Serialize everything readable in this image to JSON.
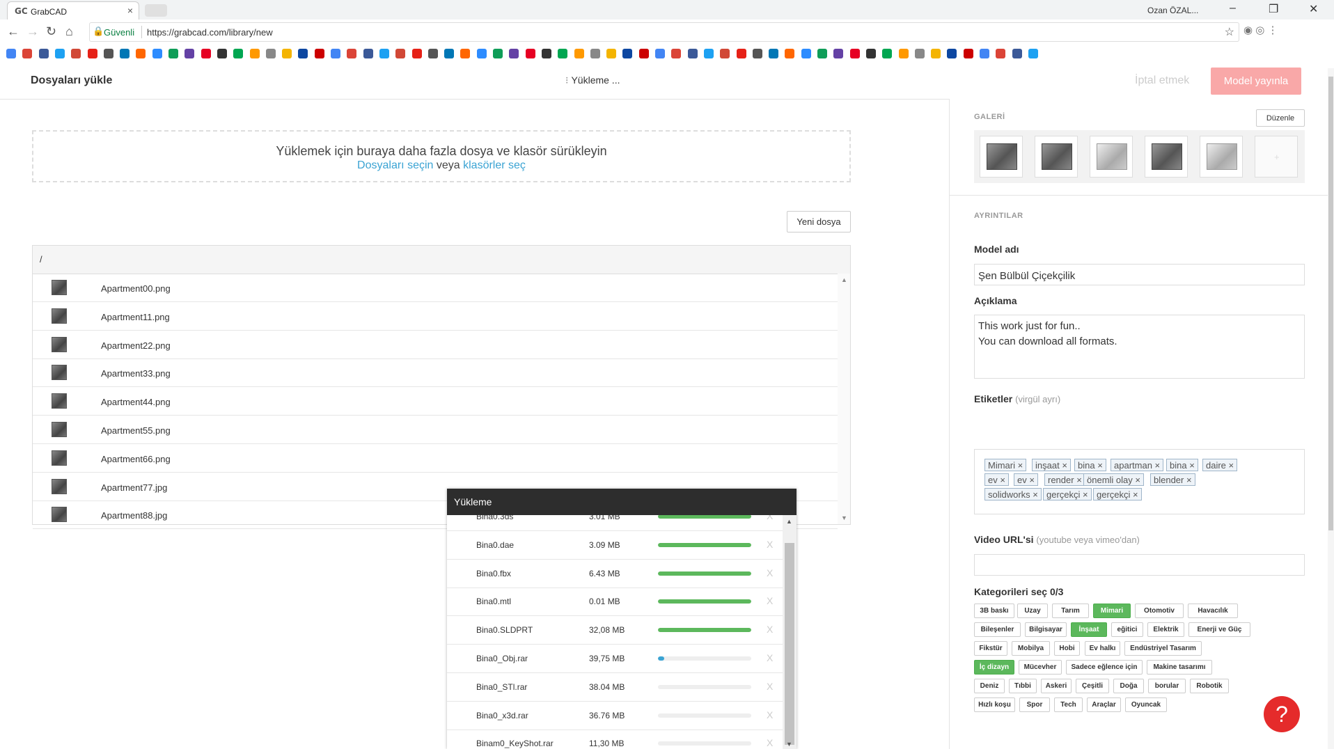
{
  "browser": {
    "tab_title": "GrabCAD",
    "tab_favicon": "GC",
    "user_name": "Ozan ÖZAL...",
    "secure_label": "Güvenli",
    "url": "https://grabcad.com/library/new"
  },
  "header": {
    "title": "Dosyaları yükle",
    "status": "Yükleme ...",
    "cancel_label": "İptal etmek",
    "publish_label": "Model yayınla"
  },
  "dropzone": {
    "line1": "Yüklemek için buraya daha fazla dosya ve klasör sürükleyin",
    "select_files": "Dosyaları seçin",
    "or": "veya",
    "select_folders": "klasörler seç"
  },
  "files": {
    "new_file_label": "Yeni dosya",
    "path": "/",
    "items": [
      "Apartment00.png",
      "Apartment11.png",
      "Apartment22.png",
      "Apartment33.png",
      "Apartment44.png",
      "Apartment55.png",
      "Apartment66.png",
      "Apartment77.jpg",
      "Apartment88.jpg"
    ]
  },
  "upload": {
    "title": "Yükleme",
    "items": [
      {
        "name": "Bina0.3ds",
        "size": "3.01 MB",
        "progress": 1.0
      },
      {
        "name": "Bina0.dae",
        "size": "3.09 MB",
        "progress": 1.0
      },
      {
        "name": "Bina0.fbx",
        "size": "6.43 MB",
        "progress": 1.0
      },
      {
        "name": "Bina0.mtl",
        "size": "0.01 MB",
        "progress": 1.0
      },
      {
        "name": "Bina0.SLDPRT",
        "size": "32,08 MB",
        "progress": 1.0
      },
      {
        "name": "Bina0_Obj.rar",
        "size": "39,75 MB",
        "progress": 0.07
      },
      {
        "name": "Bina0_STl.rar",
        "size": "38.04 MB",
        "progress": 0
      },
      {
        "name": "Bina0_x3d.rar",
        "size": "36.76 MB",
        "progress": 0
      },
      {
        "name": "Binam0_KeyShot.rar",
        "size": "11,30 MB",
        "progress": 0
      }
    ]
  },
  "right": {
    "gallery_label": "GALERİ",
    "edit_label": "Düzenle",
    "gallery_placeholder": "+",
    "details_label": "AYRINTILAR",
    "model_name_label": "Model adı",
    "model_name_value": "Şen Bülbül Çiçekçilik",
    "description_label": "Açıklama",
    "description_value": "This work just for fun..\nYou can download all formats.",
    "tags_label": "Etiketler",
    "tags_hint": "(virgül ayrı)",
    "tags": [
      "Mimari",
      "inşaat",
      "bina",
      "apartman",
      "bina",
      "daire",
      "ev",
      "ev",
      "render",
      "önemli olay",
      "blender",
      "solidworks",
      "gerçekçi",
      "gerçekçi"
    ],
    "video_label": "Video URL'si",
    "video_hint": "(youtube veya vimeo'dan)",
    "categories_label": "Kategorileri seç 0/3",
    "categories": [
      {
        "label": "3B baskı",
        "on": false
      },
      {
        "label": "Uzay",
        "on": false
      },
      {
        "label": "Tarım",
        "on": false
      },
      {
        "label": "Mimari",
        "on": true
      },
      {
        "label": "Otomotiv",
        "on": false
      },
      {
        "label": "Havacılık",
        "on": false
      },
      {
        "label": "Bileşenler",
        "on": false
      },
      {
        "label": "Bilgisayar",
        "on": false
      },
      {
        "label": "İnşaat",
        "on": true
      },
      {
        "label": "eğitici",
        "on": false
      },
      {
        "label": "Elektrik",
        "on": false
      },
      {
        "label": "Enerji ve Güç",
        "on": false
      },
      {
        "label": "Fikstür",
        "on": false
      },
      {
        "label": "Mobilya",
        "on": false
      },
      {
        "label": "Hobi",
        "on": false
      },
      {
        "label": "Ev halkı",
        "on": false
      },
      {
        "label": "Endüstriyel Tasarım",
        "on": false
      },
      {
        "label": "İç dizayn",
        "on": true
      },
      {
        "label": "Mücevher",
        "on": false
      },
      {
        "label": "Sadece eğlence için",
        "on": false
      },
      {
        "label": "Makine tasarımı",
        "on": false
      },
      {
        "label": "Deniz",
        "on": false
      },
      {
        "label": "Tıbbi",
        "on": false
      },
      {
        "label": "Askeri",
        "on": false
      },
      {
        "label": "Çeşitli",
        "on": false
      },
      {
        "label": "Doğa",
        "on": false
      },
      {
        "label": "borular",
        "on": false
      },
      {
        "label": "Robotik",
        "on": false
      },
      {
        "label": "Hızlı koşu",
        "on": false
      },
      {
        "label": "Spor",
        "on": false
      },
      {
        "label": "Tech",
        "on": false
      },
      {
        "label": "Araçlar",
        "on": false
      },
      {
        "label": "Oyuncak",
        "on": false
      }
    ]
  },
  "colors": {
    "accent": "#3aa3d3",
    "publish": "#f9a8a8",
    "active_category": "#5cb85c",
    "help": "#e52b2b"
  }
}
